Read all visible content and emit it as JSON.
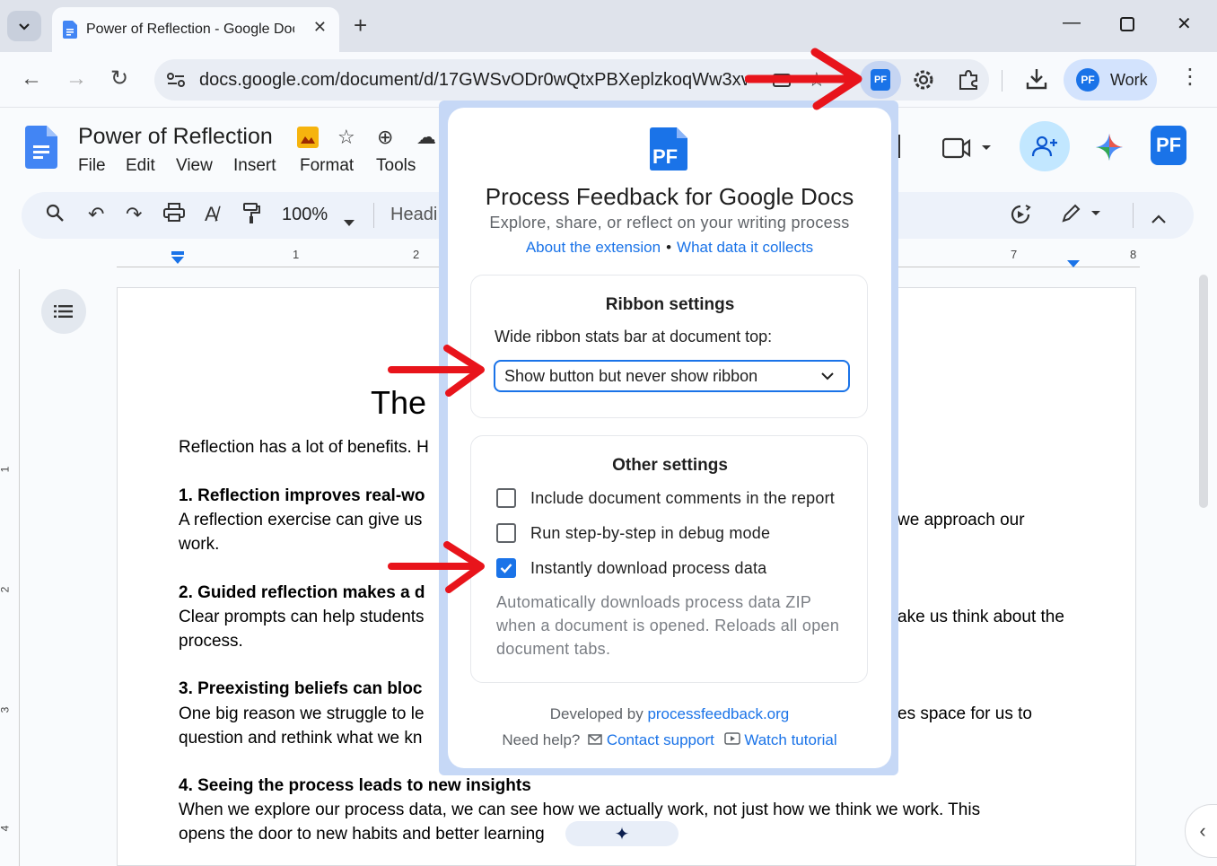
{
  "browser": {
    "tab_title": "Power of Reflection - Google Docs",
    "url": "docs.google.com/document/d/17GWSvODr0wQtxPBXeplzkoqWw3xv...",
    "profile_label": "Work",
    "extension_badge": "PF"
  },
  "docs": {
    "title": "Power of Reflection",
    "menu": [
      "File",
      "Edit",
      "View",
      "Insert",
      "Format",
      "Tools"
    ],
    "zoom": "100%",
    "style": "Headi",
    "ruler_numbers": [
      "1",
      "2",
      "7",
      "8"
    ],
    "vruler_numbers": [
      "1",
      "2",
      "3",
      "4"
    ],
    "heading": "The",
    "lines": [
      {
        "text": "Reflection has a lot of benefits. H",
        "bold": false
      },
      {
        "text": "1. Reflection improves real-wo",
        "bold": true
      },
      {
        "text": "A reflection exercise can give us",
        "bold": false
      },
      {
        "text": "work.",
        "bold": false
      },
      {
        "text": "2. Guided reflection makes a d",
        "bold": true
      },
      {
        "text": "Clear prompts can help students",
        "bold": false
      },
      {
        "text": "process.",
        "bold": false
      },
      {
        "text": "3. Preexisting beliefs can bloc",
        "bold": true
      },
      {
        "text": "One big reason we struggle to le",
        "bold": false
      },
      {
        "text": "question and rethink what we kn",
        "bold": false
      },
      {
        "text": "4. Seeing the process leads to new insights",
        "bold": true
      },
      {
        "text": "When we explore our process data, we can see how we actually work, not just how we think we work. This",
        "bold": false
      },
      {
        "text": "opens the door to new habits and better learning",
        "bold": false
      }
    ],
    "right_fragments": [
      "we approach our",
      "ake us think about the",
      "es space for us to"
    ]
  },
  "popup": {
    "logo": "PF",
    "title": "Process Feedback for Google Docs",
    "subtitle": "Explore, share, or reflect on your writing process",
    "link_about": "About the extension",
    "link_separator": "•",
    "link_data": "What data it collects",
    "ribbon": {
      "title": "Ribbon settings",
      "label": "Wide ribbon stats bar at document top:",
      "selected": "Show button but never show ribbon"
    },
    "other": {
      "title": "Other settings",
      "options": [
        {
          "label": "Include document comments in the report",
          "checked": false
        },
        {
          "label": "Run step-by-step in debug mode",
          "checked": false
        },
        {
          "label": "Instantly download process data",
          "checked": true
        }
      ],
      "help": "Automatically downloads process data ZIP when a document is opened. Reloads all open document tabs."
    },
    "footer": {
      "developed_by": "Developed by",
      "dev_link": "processfeedback.org",
      "need_help": "Need help?",
      "contact": "Contact support",
      "tutorial": "Watch tutorial"
    }
  },
  "colors": {
    "accent": "#1a73e8",
    "annotation_arrow": "#e8141b",
    "popup_frame": "#c6d8f6"
  }
}
